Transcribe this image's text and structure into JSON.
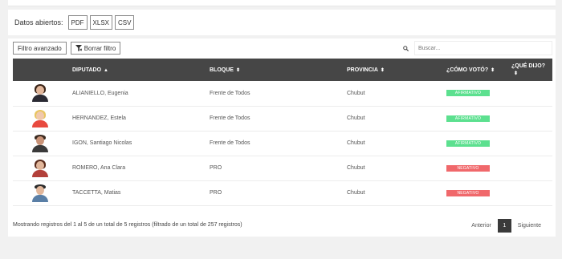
{
  "open_data": {
    "label": "Datos abiertos:",
    "buttons": [
      "PDF",
      "XLSX",
      "CSV"
    ]
  },
  "toolbar": {
    "advanced_filter": "Filtro avanzado",
    "clear_filter": "Borrar filtro",
    "search_placeholder": "Buscar..."
  },
  "table": {
    "headers": {
      "diputado": "DIPUTADO",
      "bloque": "BLOQUE",
      "provincia": "PROVINCIA",
      "voto": "¿CÓMO VOTÓ?",
      "dijo": "¿QUÉ DIJO?"
    },
    "rows": [
      {
        "name": "ALIANIELLO, Eugenia",
        "bloque": "Frente de Todos",
        "provincia": "Chubut",
        "voto": "AFIRMATIVO"
      },
      {
        "name": "HERNANDEZ, Estela",
        "bloque": "Frente de Todos",
        "provincia": "Chubut",
        "voto": "AFIRMATIVO"
      },
      {
        "name": "IGON, Santiago Nicolas",
        "bloque": "Frente de Todos",
        "provincia": "Chubut",
        "voto": "AFIRMATIVO"
      },
      {
        "name": "ROMERO, Ana Clara",
        "bloque": "PRO",
        "provincia": "Chubut",
        "voto": "NEGATIVO"
      },
      {
        "name": "TACCETTA, Matias",
        "bloque": "PRO",
        "provincia": "Chubut",
        "voto": "NEGATIVO"
      }
    ]
  },
  "colors": {
    "afirmativo": "#5ce08f",
    "negativo": "#f0686b",
    "header_bg": "#464646"
  },
  "footer": {
    "info": "Mostrando registros del 1 al 5 de un total de 5 registros (filtrado de un total de 257 registros)",
    "prev": "Anterior",
    "page": "1",
    "next": "Siguiente"
  }
}
